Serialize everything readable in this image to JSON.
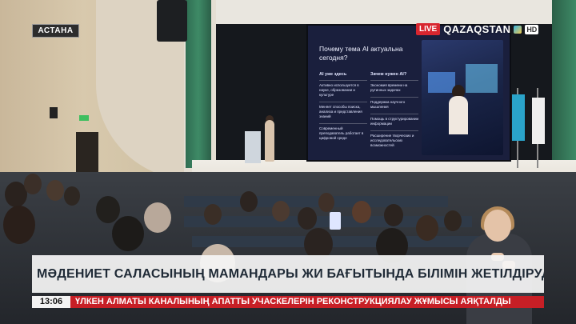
{
  "location": "АСТАНА",
  "brand": {
    "live": "LIVE",
    "channel": "QAZAQSTAN",
    "quality": "HD"
  },
  "slide": {
    "title": "Почему тема AI актуальна сегодня?",
    "col1_heading": "AI уже здесь",
    "col1_items": [
      "Активно используется в науке, образовании и культуре",
      "Меняет способы поиска, анализа и представления знаний",
      "Современный преподаватель работает в цифровой среде"
    ],
    "col2_heading": "Зачем нужен AI?",
    "col2_items": [
      "Экономия времени на рутинных задачах",
      "Поддержка научного мышления",
      "Помощь в структурировании информации",
      "Расширение творческих и исследовательских возможностей"
    ]
  },
  "headline": "МӘДЕНИЕТ САЛАСЫНЫҢ МАМАНДАРЫ ЖИ БАҒЫТЫНДА БІЛІМІН ЖЕТІЛДІРУДЕ",
  "clock": "13:06",
  "ticker": "ҮЛКЕН АЛМАТЫ КАНАЛЫНЫҢ АПАТТЫ УЧАСКЕЛЕРІН РЕКОНСТРУКЦИЯЛАУ ЖҰМЫСЫ АЯҚТАЛДЫ",
  "colors": {
    "live_red": "#d8262f",
    "ticker_red": "#c71f26",
    "headline_bg": "#f5f5f5",
    "slide_bg": "#1a1f3d"
  }
}
